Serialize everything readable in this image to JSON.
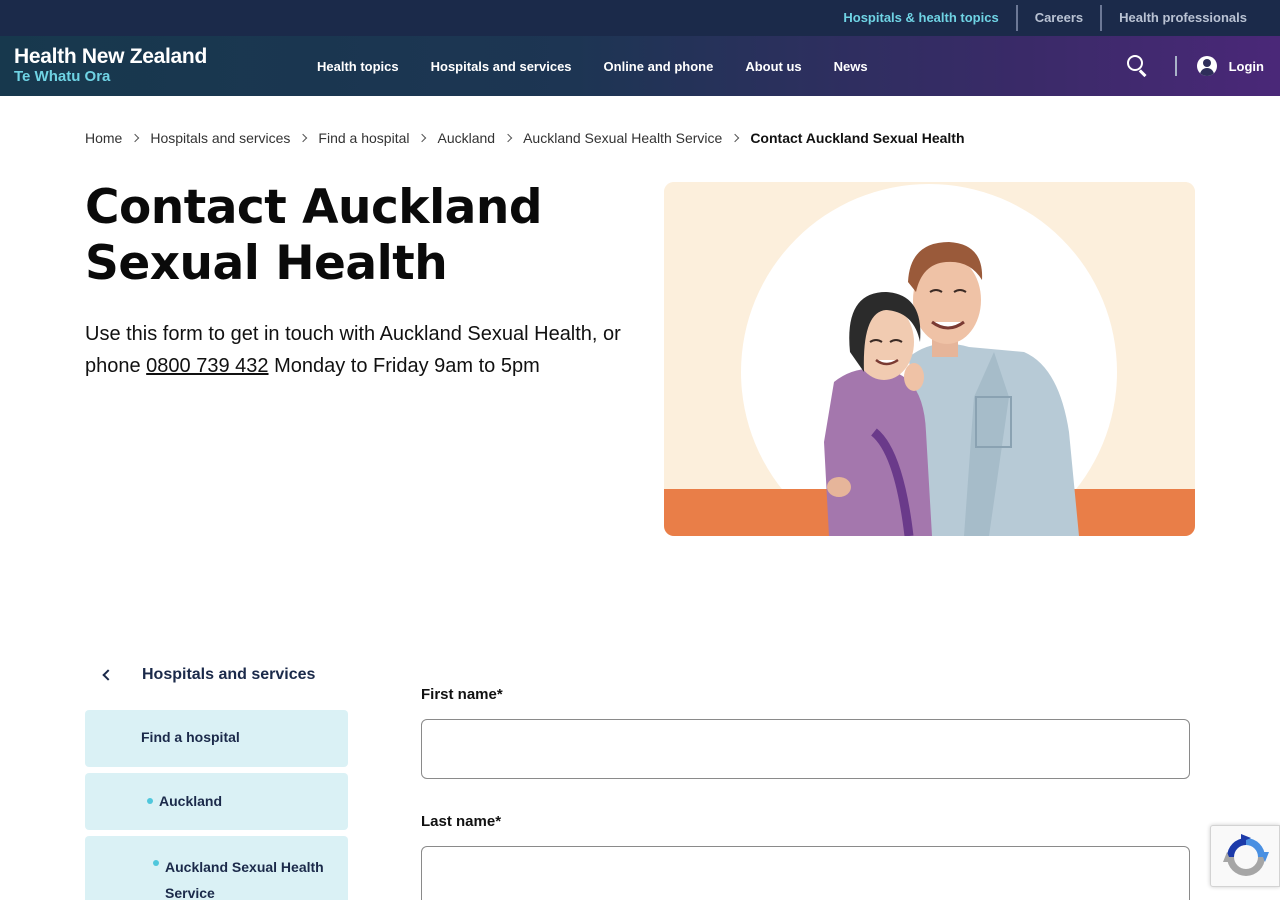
{
  "utility_nav": {
    "items": [
      {
        "label": "Hospitals & health topics"
      },
      {
        "label": "Careers"
      },
      {
        "label": "Health professionals"
      }
    ]
  },
  "brand": {
    "name": "Health New Zealand",
    "subtitle": "Te Whatu Ora"
  },
  "main_nav": {
    "items": [
      {
        "label": "Health topics"
      },
      {
        "label": "Hospitals and services"
      },
      {
        "label": "Online and phone"
      },
      {
        "label": "About us"
      },
      {
        "label": "News"
      }
    ]
  },
  "header_tools": {
    "login_label": "Login",
    "search_icon": "search-icon",
    "user_icon": "user-icon"
  },
  "breadcrumb": [
    {
      "label": "Home"
    },
    {
      "label": "Hospitals and services"
    },
    {
      "label": "Find a hospital"
    },
    {
      "label": "Auckland"
    },
    {
      "label": "Auckland Sexual Health Service"
    },
    {
      "label": "Contact Auckland Sexual Health"
    }
  ],
  "page": {
    "title": "Contact Auckland Sexual Health",
    "intro_before": "Use this form to get in touch with Auckland Sexual Health, or phone ",
    "phone": "0800 739 432",
    "intro_after": " Monday to Friday 9am to 5pm"
  },
  "side_nav": {
    "back_label": "Hospitals and services",
    "items": [
      {
        "label": "Find a hospital"
      },
      {
        "label": "Auckland"
      },
      {
        "label": "Auckland Sexual Health Service"
      }
    ]
  },
  "form": {
    "fields": [
      {
        "label": "First name*",
        "value": ""
      },
      {
        "label": "Last name*",
        "value": ""
      }
    ]
  },
  "colors": {
    "utility_bar": "#1b2a4a",
    "accent_teal": "#6fd3e4",
    "side_nav_bg": "#daf1f5",
    "hero_bg": "#fcefdc",
    "hero_band": "#e97e48"
  }
}
